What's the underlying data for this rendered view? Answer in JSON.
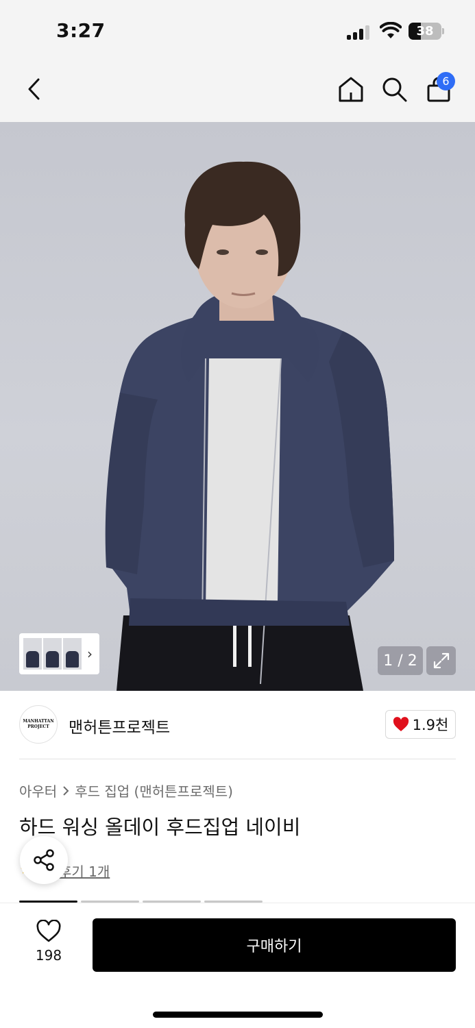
{
  "status_bar": {
    "time": "3:27",
    "battery": "38",
    "battery_level": 0.38
  },
  "nav": {
    "back_icon": "chevron-left-icon",
    "home_icon": "home-icon",
    "search_icon": "search-icon",
    "cart_icon": "shopping-bag-icon",
    "cart_count": "6"
  },
  "gallery": {
    "counter": "1 / 2",
    "expand_icon": "expand-icon",
    "thumb_arrow": "›"
  },
  "brand": {
    "logo_line1": "MANHATTAN",
    "logo_line2": "PROJECT",
    "name": "맨허튼프로젝트",
    "like_count": "1.9천"
  },
  "product": {
    "breadcrumb": [
      "아우터",
      "후드 집업 (맨허튼프로젝트)"
    ],
    "title": "하드 워싱 올데이 후드집업 네이비",
    "review_link": "후기 1개"
  },
  "bottom_bar": {
    "wish_count": "198",
    "buy_label": "구매하기"
  },
  "colors": {
    "accent_badge": "#2f6df6",
    "heart": "#e0101c",
    "buy_button": "#000000"
  }
}
